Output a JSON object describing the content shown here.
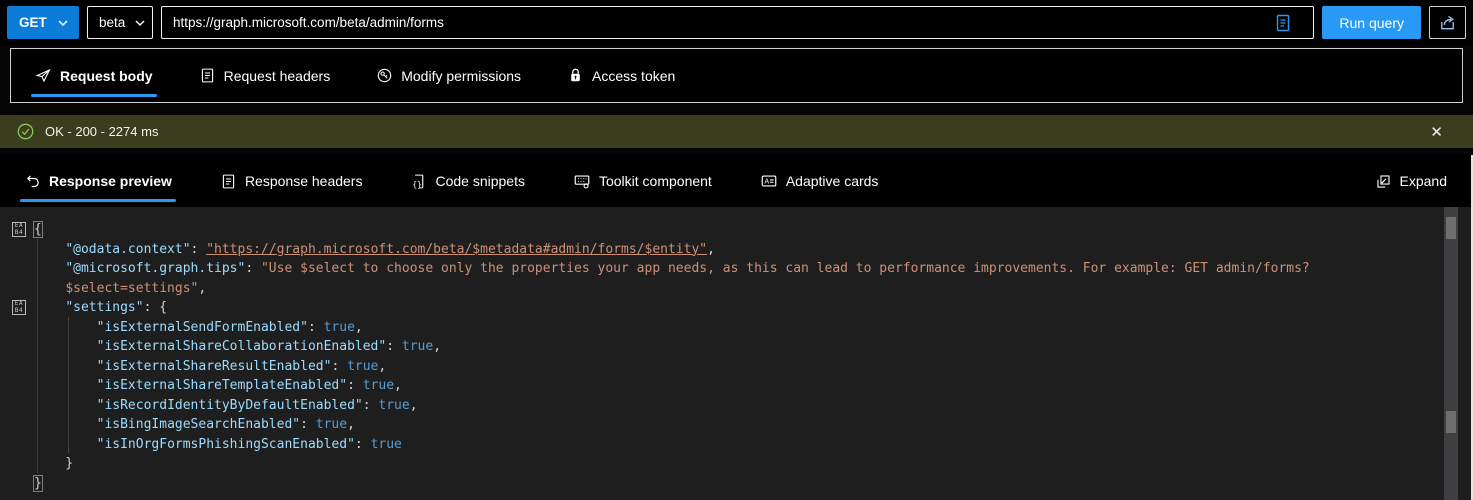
{
  "request_bar": {
    "method": "GET",
    "version": "beta",
    "url": "https://graph.microsoft.com/beta/admin/forms",
    "run_label": "Run query"
  },
  "request_tabs": {
    "body": "Request body",
    "headers": "Request headers",
    "permissions": "Modify permissions",
    "token": "Access token"
  },
  "status_bar": {
    "text": "OK - 200 - 2274 ms",
    "background": "#3b3e1e",
    "check_color": "#92c353"
  },
  "response_tabs": {
    "preview": "Response preview",
    "headers": "Response headers",
    "snippets": "Code snippets",
    "toolkit": "Toolkit component",
    "cards": "Adaptive cards",
    "expand": "Expand"
  },
  "colors": {
    "accent": "#2899f5",
    "method_bg": "#0b7dd8",
    "editor_bg": "#1e1e1e",
    "key": "#9cdcfe",
    "string": "#ce9178",
    "boolean": "#569cd6",
    "punctuation": "#d4d4d4"
  },
  "code": {
    "lines": [
      {
        "fold": true,
        "segments": [
          {
            "t": "{",
            "y": "punc",
            "box": true
          }
        ]
      },
      {
        "segments": [
          {
            "t": "    ",
            "y": "punc"
          },
          {
            "t": "\"@odata.context\"",
            "y": "key"
          },
          {
            "t": ": ",
            "y": "punc"
          },
          {
            "t": "\"https://graph.microsoft.com/beta/$metadata#admin/forms/$entity\"",
            "y": "link"
          },
          {
            "t": ",",
            "y": "punc"
          }
        ]
      },
      {
        "segments": [
          {
            "t": "    ",
            "y": "punc"
          },
          {
            "t": "\"@microsoft.graph.tips\"",
            "y": "key"
          },
          {
            "t": ": ",
            "y": "punc"
          },
          {
            "t": "\"Use $select to choose only the properties your app needs, as this can lead to performance improvements. For example: GET admin/forms?",
            "y": "string"
          }
        ]
      },
      {
        "segments": [
          {
            "t": "    ",
            "y": "punc"
          },
          {
            "t": "$select=settings\"",
            "y": "string"
          },
          {
            "t": ",",
            "y": "punc"
          }
        ]
      },
      {
        "fold": true,
        "segments": [
          {
            "t": "    ",
            "y": "punc"
          },
          {
            "t": "\"settings\"",
            "y": "key"
          },
          {
            "t": ": {",
            "y": "punc"
          }
        ]
      },
      {
        "segments": [
          {
            "t": "        ",
            "y": "punc"
          },
          {
            "t": "\"isExternalSendFormEnabled\"",
            "y": "key"
          },
          {
            "t": ": ",
            "y": "punc"
          },
          {
            "t": "true",
            "y": "bool"
          },
          {
            "t": ",",
            "y": "punc"
          }
        ]
      },
      {
        "segments": [
          {
            "t": "        ",
            "y": "punc"
          },
          {
            "t": "\"isExternalShareCollaborationEnabled\"",
            "y": "key"
          },
          {
            "t": ": ",
            "y": "punc"
          },
          {
            "t": "true",
            "y": "bool"
          },
          {
            "t": ",",
            "y": "punc"
          }
        ]
      },
      {
        "segments": [
          {
            "t": "        ",
            "y": "punc"
          },
          {
            "t": "\"isExternalShareResultEnabled\"",
            "y": "key"
          },
          {
            "t": ": ",
            "y": "punc"
          },
          {
            "t": "true",
            "y": "bool"
          },
          {
            "t": ",",
            "y": "punc"
          }
        ]
      },
      {
        "segments": [
          {
            "t": "        ",
            "y": "punc"
          },
          {
            "t": "\"isExternalShareTemplateEnabled\"",
            "y": "key"
          },
          {
            "t": ": ",
            "y": "punc"
          },
          {
            "t": "true",
            "y": "bool"
          },
          {
            "t": ",",
            "y": "punc"
          }
        ]
      },
      {
        "segments": [
          {
            "t": "        ",
            "y": "punc"
          },
          {
            "t": "\"isRecordIdentityByDefaultEnabled\"",
            "y": "key"
          },
          {
            "t": ": ",
            "y": "punc"
          },
          {
            "t": "true",
            "y": "bool"
          },
          {
            "t": ",",
            "y": "punc"
          }
        ]
      },
      {
        "segments": [
          {
            "t": "        ",
            "y": "punc"
          },
          {
            "t": "\"isBingImageSearchEnabled\"",
            "y": "key"
          },
          {
            "t": ": ",
            "y": "punc"
          },
          {
            "t": "true",
            "y": "bool"
          },
          {
            "t": ",",
            "y": "punc"
          }
        ]
      },
      {
        "segments": [
          {
            "t": "        ",
            "y": "punc"
          },
          {
            "t": "\"isInOrgFormsPhishingScanEnabled\"",
            "y": "key"
          },
          {
            "t": ": ",
            "y": "punc"
          },
          {
            "t": "true",
            "y": "bool"
          }
        ]
      },
      {
        "segments": [
          {
            "t": "    }",
            "y": "punc"
          }
        ]
      },
      {
        "segments": [
          {
            "t": "}",
            "y": "punc",
            "box": true
          }
        ]
      }
    ]
  }
}
